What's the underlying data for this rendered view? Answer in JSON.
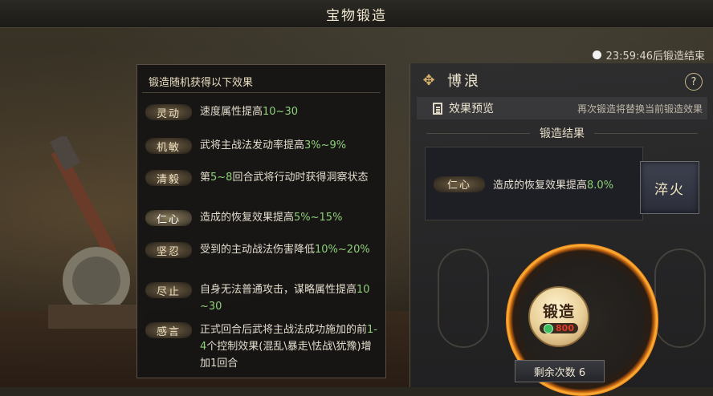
{
  "window": {
    "title": "宝物锻造"
  },
  "timer": {
    "text": "23:59:46后锻造结束"
  },
  "tooltip": {
    "heading": "锻造随机获得以下效果",
    "effects": [
      {
        "tag": "灵动",
        "parts": [
          "速度属性提高",
          "10~30"
        ]
      },
      {
        "tag": "机敏",
        "parts": [
          "武将主战法发动率提高",
          "3%~9%"
        ]
      },
      {
        "tag": "清毅",
        "parts": [
          "第",
          "5~8",
          "回合武将行动时获得洞察状态"
        ]
      },
      {
        "tag": "仁心",
        "parts": [
          "造成的恢复效果提高",
          "5%~15%"
        ]
      },
      {
        "tag": "坚忍",
        "parts": [
          "受到的主动战法伤害降低",
          "10%~20%"
        ]
      },
      {
        "tag": "尽止",
        "parts": [
          "自身无法普通攻击，谋略属性提高",
          "10~30"
        ]
      },
      {
        "tag": "感言",
        "parts": [
          "正式回合后武将主战法成功施加的前",
          "1-4",
          "个控制效果(混乱\\暴走\\怯战\\犹豫)增加1回合"
        ]
      }
    ]
  },
  "panel": {
    "hero_icon": "hero-emblem-icon",
    "hero_name": "博浪",
    "help_label": "?",
    "preview_label": "效果预览",
    "preview_hint": "再次锻造将替换当前锻造效果",
    "result_heading": "锻造结果",
    "result_tag": "仁心",
    "result_text": "造成的恢复效果提高",
    "result_value": "8.0%",
    "quench_label": "淬火"
  },
  "forge": {
    "label": "锻造",
    "cost": "800",
    "remaining": "剩余次数 6"
  },
  "colors": {
    "accent_green": "#8fd07a",
    "cost_red": "#e13b28",
    "ember": "#ffb338"
  }
}
